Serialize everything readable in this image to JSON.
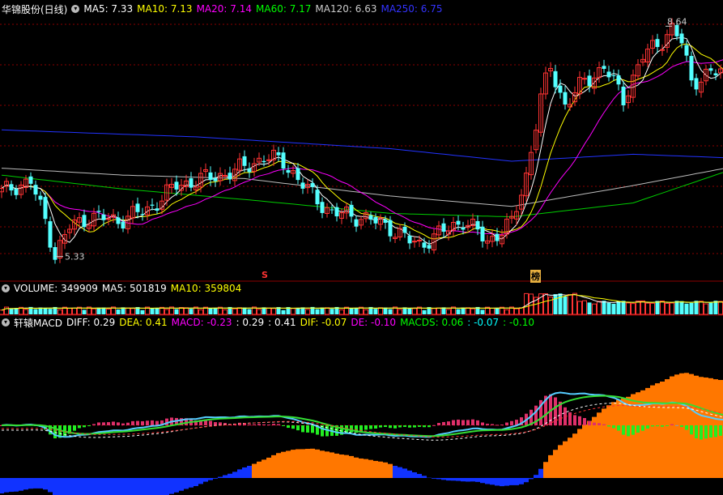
{
  "header_price": {
    "title": "华锦股份(日线)",
    "items": [
      {
        "label": "MA5: 7.33",
        "color": "#ffffff"
      },
      {
        "label": "MA10: 7.13",
        "color": "#ffff00"
      },
      {
        "label": "MA20: 7.14",
        "color": "#ff00ff"
      },
      {
        "label": "MA60: 7.17",
        "color": "#00ff00"
      },
      {
        "label": "MA120: 6.63",
        "color": "#cccccc"
      },
      {
        "label": "MA250: 6.75",
        "color": "#3333ff"
      }
    ]
  },
  "header_volume": {
    "items": [
      {
        "label": "VOLUME: 349909",
        "color": "#ffffff"
      },
      {
        "label": "MA5: 501819",
        "color": "#ffffff"
      },
      {
        "label": "MA10: 359804",
        "color": "#ffff00"
      }
    ]
  },
  "header_macd": {
    "title": "轩辕MACD",
    "items": [
      {
        "label": "DIFF: 0.29",
        "color": "#ffffff"
      },
      {
        "label": "DEA: 0.41",
        "color": "#ffff00"
      },
      {
        "label": "MACD: -0.23",
        "color": "#ff00ff"
      },
      {
        "label": ": 0.29",
        "color": "#ffffff"
      },
      {
        "label": ": 0.41",
        "color": "#ffffff"
      },
      {
        "label": "DIF: -0.07",
        "color": "#ffff00"
      },
      {
        "label": "DE: -0.10",
        "color": "#ff00ff"
      },
      {
        "label": "MACDS: 0.06",
        "color": "#00ff00"
      },
      {
        "label": ": -0.07",
        "color": "#00ffff"
      },
      {
        "label": ": -0.10",
        "color": "#00ff00"
      }
    ]
  },
  "annotations": {
    "high_label": "8.64",
    "low_label": "5.33",
    "marker_s": "S",
    "marker_b": "榜"
  },
  "colors": {
    "up": "#ff3333",
    "down": "#54ffff",
    "ma5": "#ffffff",
    "ma10": "#ffff00",
    "ma20": "#ff00ff",
    "ma60": "#00cc00",
    "ma120": "#bbbbbb",
    "ma250": "#2233ff",
    "grid": "#8b0000",
    "macd_pos": "#e0306a",
    "macd_neg": "#22ee22",
    "macd_fade": "#7d9dc0",
    "diff": "#55ccff",
    "dea": "#33dd33",
    "band_pos": "#ff7700",
    "band_neg": "#1133ff"
  },
  "chart_data": {
    "type": "candlestick",
    "title": "华锦股份(日线)",
    "ylim": [
      5.0,
      8.9
    ],
    "x_count": 150,
    "key_points": {
      "low": 5.33,
      "high": 8.64
    },
    "close_path": [
      [
        0,
        6.25
      ],
      [
        3,
        6.35
      ],
      [
        6,
        6.4
      ],
      [
        9,
        5.85
      ],
      [
        11,
        5.35
      ],
      [
        14,
        5.75
      ],
      [
        18,
        5.9
      ],
      [
        24,
        5.85
      ],
      [
        30,
        6.0
      ],
      [
        36,
        6.35
      ],
      [
        42,
        6.45
      ],
      [
        48,
        6.55
      ],
      [
        54,
        6.75
      ],
      [
        58,
        6.7
      ],
      [
        62,
        6.35
      ],
      [
        68,
        5.95
      ],
      [
        74,
        5.9
      ],
      [
        80,
        5.75
      ],
      [
        84,
        5.55
      ],
      [
        86,
        5.5
      ],
      [
        90,
        5.65
      ],
      [
        95,
        5.85
      ],
      [
        100,
        5.55
      ],
      [
        105,
        5.8
      ],
      [
        108,
        6.5
      ],
      [
        111,
        7.6
      ],
      [
        113,
        8.05
      ],
      [
        116,
        7.5
      ],
      [
        120,
        7.85
      ],
      [
        124,
        8.05
      ],
      [
        128,
        7.6
      ],
      [
        132,
        8.2
      ],
      [
        136,
        8.45
      ],
      [
        138,
        8.6
      ],
      [
        140,
        8.4
      ],
      [
        142,
        7.85
      ],
      [
        146,
        7.95
      ],
      [
        149,
        8.0
      ]
    ],
    "ma_series": [
      {
        "name": "MA120",
        "points": [
          [
            0,
            6.6
          ],
          [
            25,
            6.5
          ],
          [
            50,
            6.45
          ],
          [
            80,
            6.2
          ],
          [
            105,
            6.05
          ],
          [
            130,
            6.35
          ],
          [
            149,
            6.6
          ]
        ]
      },
      {
        "name": "MA250",
        "points": [
          [
            0,
            7.15
          ],
          [
            40,
            7.05
          ],
          [
            80,
            6.88
          ],
          [
            105,
            6.7
          ],
          [
            130,
            6.8
          ],
          [
            149,
            6.75
          ]
        ]
      },
      {
        "name": "MA60",
        "points": [
          [
            0,
            6.5
          ],
          [
            25,
            6.3
          ],
          [
            50,
            6.15
          ],
          [
            80,
            5.95
          ],
          [
            105,
            5.9
          ],
          [
            130,
            6.1
          ],
          [
            149,
            6.55
          ]
        ]
      }
    ],
    "volume": {
      "ma5": 501819,
      "ma10": 359804,
      "last": 349909
    },
    "macd": {
      "diff": 0.29,
      "dea": 0.41,
      "macd": -0.23
    }
  }
}
